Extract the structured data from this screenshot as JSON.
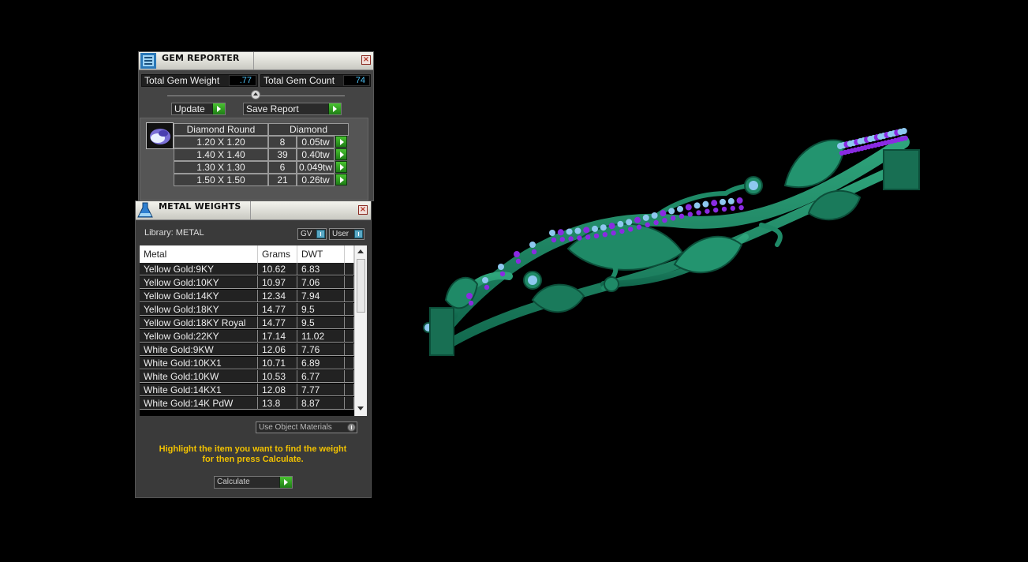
{
  "gem_reporter": {
    "title": "GEM REPORTER",
    "close_label": "×",
    "total_weight_label": "Total Gem Weight",
    "total_weight_value": ".77",
    "total_count_label": "Total Gem Count",
    "total_count_value": "74",
    "update_label": "Update",
    "save_report_label": "Save Report",
    "table": {
      "header_shape": "Diamond Round",
      "header_type": "Diamond",
      "rows": [
        {
          "size": "1.20 X 1.20",
          "count": "8",
          "weight": "0.05tw"
        },
        {
          "size": "1.40 X 1.40",
          "count": "39",
          "weight": "0.40tw"
        },
        {
          "size": "1.30 X 1.30",
          "count": "6",
          "weight": "0.049tw"
        },
        {
          "size": "1.50 X 1.50",
          "count": "21",
          "weight": "0.26tw"
        }
      ]
    }
  },
  "metal_weights": {
    "title": "METAL WEIGHTS",
    "close_label": "×",
    "library_label": "Library: METAL",
    "toggle_gv": "GV",
    "toggle_user": "User",
    "columns": [
      "Metal",
      "Grams",
      "DWT"
    ],
    "rows": [
      {
        "metal": "Yellow Gold:9KY",
        "grams": "10.62",
        "dwt": "6.83"
      },
      {
        "metal": "Yellow Gold:10KY",
        "grams": "10.97",
        "dwt": "7.06"
      },
      {
        "metal": "Yellow Gold:14KY",
        "grams": "12.34",
        "dwt": "7.94"
      },
      {
        "metal": "Yellow Gold:18KY",
        "grams": "14.77",
        "dwt": "9.5"
      },
      {
        "metal": "Yellow Gold:18KY Royal",
        "grams": "14.77",
        "dwt": "9.5"
      },
      {
        "metal": "Yellow Gold:22KY",
        "grams": "17.14",
        "dwt": "11.02"
      },
      {
        "metal": "White Gold:9KW",
        "grams": "12.06",
        "dwt": "7.76"
      },
      {
        "metal": "White Gold:10KX1",
        "grams": "10.71",
        "dwt": "6.89"
      },
      {
        "metal": "White Gold:10KW",
        "grams": "10.53",
        "dwt": "6.77"
      },
      {
        "metal": "White Gold:14KX1",
        "grams": "12.08",
        "dwt": "7.77"
      },
      {
        "metal": "White Gold:14K PdW",
        "grams": "13.8",
        "dwt": "8.87"
      }
    ],
    "use_object_materials_label": "Use Object Materials",
    "hint_line1": "Highlight the item you want to find the weight",
    "hint_line2": "for then press Calculate.",
    "calculate_label": "Calculate"
  },
  "colors": {
    "metal_green": "#1f8a67",
    "metal_dark": "#0e5a43",
    "gem_blue": "#8ec8f0",
    "gem_purple": "#8a2be2",
    "hint_yellow": "#f2c200",
    "value_blue": "#4fc3f7"
  },
  "icons": {
    "gem_reporter": "gem-report-icon",
    "metal_weights": "metal-flask-icon",
    "gem_thumbnail": "diamond-gem-icon"
  }
}
